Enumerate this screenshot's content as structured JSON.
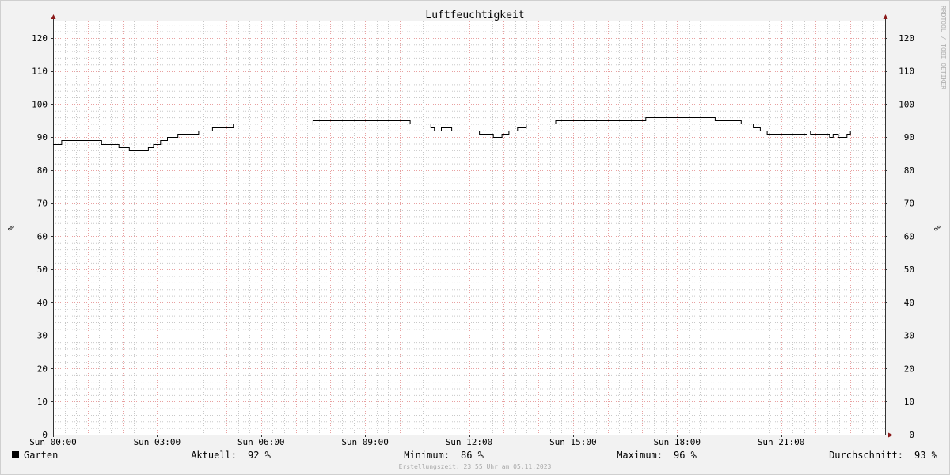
{
  "chart_data": {
    "type": "line",
    "title": "Luftfeuchtigkeit",
    "ylabel": "%",
    "ylim": [
      0,
      125
    ],
    "y_ticks": [
      0,
      10,
      20,
      30,
      40,
      50,
      60,
      70,
      80,
      90,
      100,
      110,
      120
    ],
    "x_ticks": [
      {
        "hour": 0,
        "label": "Sun 00:00"
      },
      {
        "hour": 3,
        "label": "Sun 03:00"
      },
      {
        "hour": 6,
        "label": "Sun 06:00"
      },
      {
        "hour": 9,
        "label": "Sun 09:00"
      },
      {
        "hour": 12,
        "label": "Sun 12:00"
      },
      {
        "hour": 15,
        "label": "Sun 15:00"
      },
      {
        "hour": 18,
        "label": "Sun 18:00"
      },
      {
        "hour": 21,
        "label": "Sun 21:00"
      }
    ],
    "xlim_hours": [
      0,
      24
    ],
    "grid": true,
    "series": [
      {
        "name": "Garten",
        "color": "#000000",
        "x": [
          0,
          0.25,
          0.25,
          1.4,
          1.4,
          1.9,
          1.9,
          2.2,
          2.2,
          2.75,
          2.75,
          2.9,
          2.9,
          3.1,
          3.1,
          3.3,
          3.3,
          3.6,
          3.6,
          4.2,
          4.2,
          4.6,
          4.6,
          5.2,
          5.2,
          7.5,
          7.5,
          10.3,
          10.3,
          10.9,
          10.9,
          11.0,
          11.0,
          11.2,
          11.2,
          11.5,
          11.5,
          12.3,
          12.3,
          12.7,
          12.7,
          12.95,
          12.95,
          13.15,
          13.15,
          13.4,
          13.4,
          13.65,
          13.65,
          14.5,
          14.5,
          17.1,
          17.1,
          19.1,
          19.1,
          19.85,
          19.85,
          20.2,
          20.2,
          20.4,
          20.4,
          20.6,
          20.6,
          21.75,
          21.75,
          21.85,
          21.85,
          22.4,
          22.4,
          22.5,
          22.5,
          22.65,
          22.65,
          22.9,
          22.9,
          23.0,
          23.0,
          23.75,
          23.75,
          24
        ],
        "y": [
          88,
          88,
          89,
          89,
          88,
          88,
          87,
          87,
          86,
          86,
          87,
          87,
          88,
          88,
          89,
          89,
          90,
          90,
          91,
          91,
          92,
          92,
          93,
          93,
          94,
          94,
          95,
          95,
          94,
          94,
          93,
          93,
          92,
          92,
          93,
          93,
          92,
          92,
          91,
          91,
          90,
          90,
          91,
          91,
          92,
          92,
          93,
          93,
          94,
          94,
          95,
          95,
          96,
          96,
          95,
          95,
          94,
          94,
          93,
          93,
          92,
          92,
          91,
          91,
          92,
          92,
          91,
          91,
          90,
          90,
          91,
          91,
          90,
          90,
          91,
          91,
          92,
          92,
          92,
          92
        ]
      }
    ]
  },
  "legend": {
    "series_name": "Garten",
    "color": "#000000",
    "stats": [
      {
        "label": "Aktuell:",
        "value": "92 %"
      },
      {
        "label": "Minimum:",
        "value": "86 %"
      },
      {
        "label": "Maximum:",
        "value": "96 %"
      },
      {
        "label": "Durchschnitt:",
        "value": "93 %"
      }
    ]
  },
  "watermark": "RRDTOOL / TOBI OETIKER",
  "footer": "Erstellungszeit: 23:55 Uhr am 05.11.2023",
  "colors": {
    "background": "#f2f2f2",
    "canvas": "#ffffff",
    "major_grid": "#e8a0a0",
    "minor_grid": "#c8c8c8",
    "axis": "#333333",
    "arrow": "#8b1a1a"
  }
}
